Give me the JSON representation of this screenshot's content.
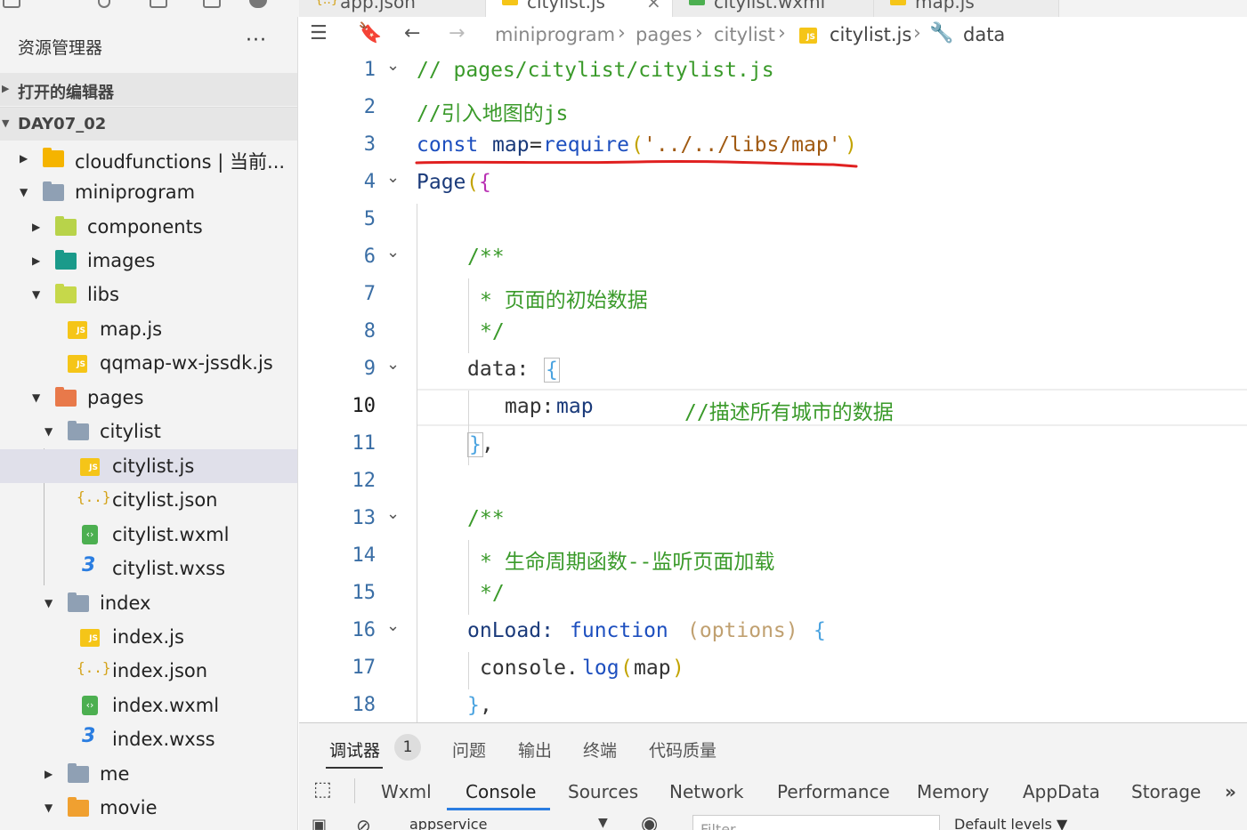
{
  "top_tabs": [
    {
      "label": "app.json",
      "icon": "json-file-icon"
    },
    {
      "label": "citylist.js",
      "icon": "js-file-icon",
      "active": true
    },
    {
      "label": "citylist.wxml",
      "icon": "wxml-file-icon"
    },
    {
      "label": "map.js",
      "icon": "js-file-icon"
    }
  ],
  "sidebar": {
    "title": "资源管理器",
    "more": "···",
    "sections": {
      "open_editors": "打开的编辑器",
      "project": "DAY07_02"
    },
    "tree": [
      {
        "label": "cloudfunctions | 当前...",
        "icon": "cloud-folder-icon",
        "expanded": false
      },
      {
        "label": "miniprogram",
        "icon": "folder-icon",
        "expanded": true
      },
      {
        "label": "components",
        "icon": "components-folder-icon",
        "expanded": false
      },
      {
        "label": "images",
        "icon": "images-folder-icon",
        "expanded": false
      },
      {
        "label": "libs",
        "icon": "libs-folder-icon",
        "expanded": true
      },
      {
        "label": "map.js",
        "icon": "js-file-icon"
      },
      {
        "label": "qqmap-wx-jssdk.js",
        "icon": "js-file-icon"
      },
      {
        "label": "pages",
        "icon": "pages-folder-icon",
        "expanded": true
      },
      {
        "label": "citylist",
        "icon": "folder-icon",
        "expanded": true
      },
      {
        "label": "citylist.js",
        "icon": "js-file-icon",
        "selected": true
      },
      {
        "label": "citylist.json",
        "icon": "json-file-icon"
      },
      {
        "label": "citylist.wxml",
        "icon": "wxml-file-icon"
      },
      {
        "label": "citylist.wxss",
        "icon": "wxss-file-icon"
      },
      {
        "label": "index",
        "icon": "folder-icon",
        "expanded": true
      },
      {
        "label": "index.js",
        "icon": "js-file-icon"
      },
      {
        "label": "index.json",
        "icon": "json-file-icon"
      },
      {
        "label": "index.wxml",
        "icon": "wxml-file-icon"
      },
      {
        "label": "index.wxss",
        "icon": "wxss-file-icon"
      },
      {
        "label": "me",
        "icon": "folder-icon",
        "expanded": false
      },
      {
        "label": "movie",
        "icon": "movie-folder-icon",
        "expanded": true
      }
    ]
  },
  "breadcrumb": {
    "items": [
      "miniprogram",
      "pages",
      "citylist",
      "citylist.js",
      "data"
    ]
  },
  "editor": {
    "current_line": 10,
    "line_numbers": [
      "1",
      "2",
      "3",
      "4",
      "5",
      "6",
      "7",
      "8",
      "9",
      "10",
      "11",
      "12",
      "13",
      "14",
      "15",
      "16",
      "17",
      "18"
    ],
    "lines": {
      "l1": "// pages/citylist/citylist.js",
      "l2": "//引入地图的js",
      "l3_kw": "const",
      "l3_id": "map",
      "l3_eq": "=",
      "l3_fn": "require",
      "l3_open": "(",
      "l3_str": "'../../libs/map'",
      "l3_close": ")",
      "l4_fn": "Page",
      "l4_open": "(",
      "l4_brace": "{",
      "l6": "/**",
      "l7": "* 页面的初始数据",
      "l8": "*/",
      "l9_key": "data:",
      "l9_brace": "{",
      "l10_key": "map:",
      "l10_val": "map",
      "l10_comment": "//描述所有城市的数据",
      "l11_brace": "}",
      "l11_comma": ",",
      "l13": "/**",
      "l14": "* 生命周期函数--监听页面加载",
      "l15": "*/",
      "l16_key": "onLoad:",
      "l16_kw": "function",
      "l16_params": "(options)",
      "l16_brace": "{",
      "l17_obj": "console.",
      "l17_fn": "log",
      "l17_open": "(",
      "l17_arg": "map",
      "l17_close": ")",
      "l18_brace": "}",
      "l18_comma": ","
    }
  },
  "panel": {
    "tabs": [
      "调试器",
      "问题",
      "输出",
      "终端",
      "代码质量"
    ],
    "badge": "1",
    "devtools_tabs": [
      "Wxml",
      "Console",
      "Sources",
      "Network",
      "Performance",
      "Memory",
      "AppData",
      "Storage"
    ],
    "active_devtools_tab": "Console",
    "overflow": "»",
    "context_select": "appservice",
    "filter_placeholder": "Filter",
    "levels": "Default levels ▼"
  },
  "colors": {
    "accent": "#2a7de1",
    "annotation": "#e02020",
    "comment": "#3a9a2a",
    "keyword": "#1d4fbf",
    "string": "#a05a12"
  }
}
